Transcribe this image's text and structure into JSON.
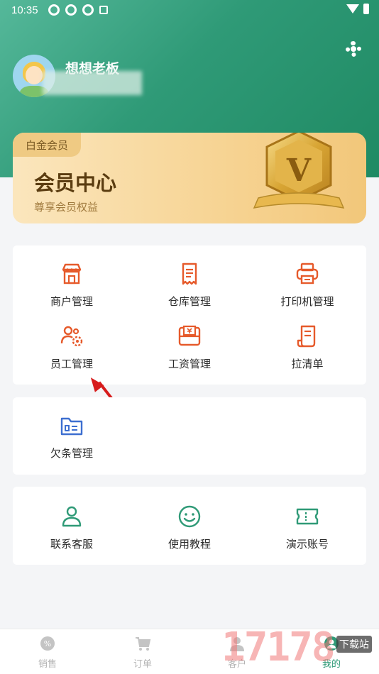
{
  "status_bar": {
    "time": "10:35"
  },
  "profile": {
    "username": "想想老板"
  },
  "vip": {
    "tag": "白金会员",
    "title": "会员中心",
    "subtitle": "尊享会员权益",
    "badge_letter": "V"
  },
  "services": [
    {
      "label": "商户管理",
      "icon": "shop-icon"
    },
    {
      "label": "仓库管理",
      "icon": "receipt-icon"
    },
    {
      "label": "打印机管理",
      "icon": "printer-icon"
    },
    {
      "label": "员工管理",
      "icon": "staff-icon"
    },
    {
      "label": "工资管理",
      "icon": "salary-icon"
    },
    {
      "label": "拉清单",
      "icon": "list-icon"
    }
  ],
  "debt": {
    "label": "欠条管理",
    "icon": "folder-icon"
  },
  "support": [
    {
      "label": "联系客服",
      "icon": "person-icon"
    },
    {
      "label": "使用教程",
      "icon": "smile-icon"
    },
    {
      "label": "演示账号",
      "icon": "ticket-icon"
    }
  ],
  "tabbar": [
    {
      "label": "销售",
      "icon": "sale-icon",
      "active": false
    },
    {
      "label": "订单",
      "icon": "cart-icon",
      "active": false
    },
    {
      "label": "客户",
      "icon": "customer-icon",
      "active": false
    },
    {
      "label": "我的",
      "icon": "me-icon",
      "active": true
    }
  ],
  "watermark": {
    "number": "17178",
    "site": "下载站"
  },
  "colors": {
    "brand_green": "#2f9a77",
    "icon_orange": "#e65a2b",
    "icon_blue": "#3d6fd0",
    "icon_green": "#2f9a77",
    "gold": "#f2c77a"
  }
}
